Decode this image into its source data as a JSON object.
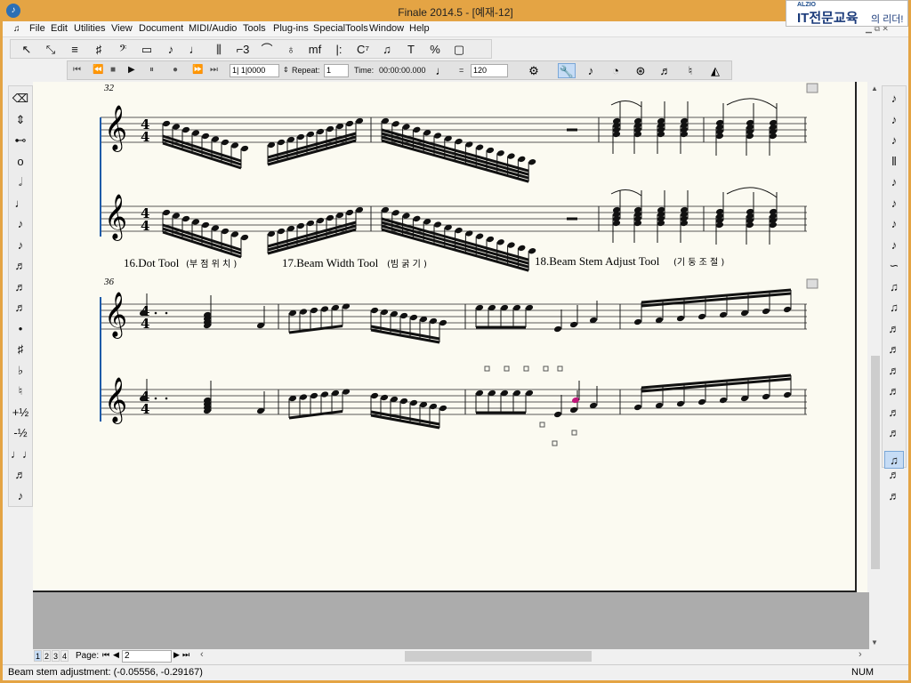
{
  "window": {
    "title": "Finale 2014.5 - [예재-12]",
    "brand_small": "ALZIO",
    "brand_main": "IT전문교육",
    "brand_tail": "의 리더!"
  },
  "menu": [
    "File",
    "Edit",
    "Utilities",
    "View",
    "Document",
    "MIDI/Audio",
    "Tools",
    "Plug-ins",
    "SpecialTools",
    "Window",
    "Help"
  ],
  "main_tools": [
    "selection-tool",
    "resize-tool",
    "staff-tool",
    "key-signature-tool",
    "clef-tool",
    "measure-tool",
    "simple-entry-tool",
    "speedy-entry-tool",
    "hyperscribe-tool",
    "tuplet-tool",
    "smart-shape-tool",
    "articulation-tool",
    "expression-tool",
    "repeat-tool",
    "chord-tool",
    "lyrics-tool",
    "text-tool",
    "mirror-tool",
    "page-layout-tool"
  ],
  "main_tool_glyphs": [
    "↖",
    "⤡",
    "≡",
    "♯",
    "𝄢",
    "▭",
    "♪",
    "♩",
    "⫼",
    "⌐3",
    "⌒",
    "♁",
    "mf",
    "|:",
    "C⁷",
    "♫",
    "T",
    "%",
    "▢"
  ],
  "playback": {
    "counter": "1| 1|0000",
    "repeat_label": "Repeat:",
    "repeat_value": "1",
    "time_label": "Time:",
    "time_value": "00:00:00.000",
    "equals": "=",
    "tempo": "120"
  },
  "score": {
    "measure_32": "32",
    "measure_36": "36",
    "caption_16": "16.Dot Tool",
    "caption_16_ko": "(부 점 위 치 )",
    "caption_17": "17.Beam Width Tool",
    "caption_17_ko": "(빔 굵 기 )",
    "caption_18": "18.Beam Stem Adjust Tool",
    "caption_18_ko": "(기 둥 조 절 )",
    "time_sig_num": "4",
    "time_sig_den": "4"
  },
  "left_palette": [
    "⌫",
    "⇕",
    "⊷",
    "o",
    "𝅗𝅥",
    "♩",
    "♪",
    "♪",
    "♬",
    "♬",
    "♬",
    "•",
    "♯",
    "♭",
    "♮",
    "+½",
    "-½",
    "♩♩",
    "♬",
    "♪"
  ],
  "right_palette": [
    "♪",
    "♪",
    "♪",
    "⫴",
    "♪",
    "♪",
    "♪",
    "♪",
    "∽",
    "♫",
    "♫",
    "♬",
    "♬",
    "♬",
    "♬",
    "♬",
    "♬",
    "♬",
    "♬",
    "♬"
  ],
  "nav": {
    "pages": [
      "1",
      "2",
      "3",
      "4"
    ],
    "page_label": "Page:",
    "page_value": "2"
  },
  "status": {
    "text": "Beam stem adjustment:  (-0.05556, -0.29167)",
    "num": "NUM"
  },
  "colors": {
    "frame": "#e4a444",
    "canvas": "#fbfaf1",
    "selected_note": "#c0187a"
  }
}
